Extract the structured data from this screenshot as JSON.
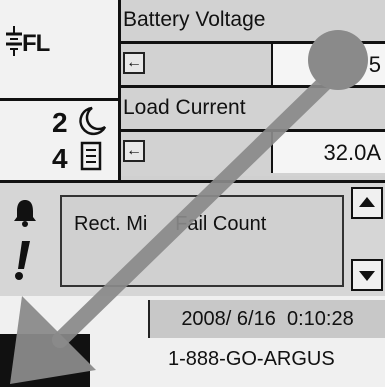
{
  "status": {
    "fl_label": "FL",
    "alarm_count": "2",
    "log_count": "4"
  },
  "readings": {
    "battery_voltage_label": "Battery Voltage",
    "battery_voltage_value": "5",
    "load_current_label": "Load Current",
    "load_current_value": "32.0A",
    "nav_arrow": "←"
  },
  "alarms": {
    "items": [
      "Rect. Minor Fail Count"
    ],
    "visible_item_text": "Rect. Mi     Fail Count"
  },
  "footer": {
    "datetime": "2008/ 6/16  0:10:28",
    "phone": "1-888-GO-ARGUS"
  }
}
